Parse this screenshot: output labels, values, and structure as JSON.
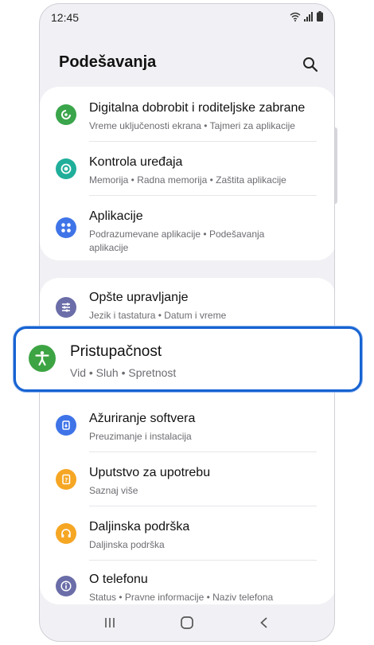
{
  "status": {
    "time": "12:45"
  },
  "header": {
    "title": "Podešavanja"
  },
  "groups": [
    {
      "items": [
        {
          "title": "Digitalna dobrobit i roditeljske zabrane",
          "subtitle": "Vreme uključenosti ekrana  •  Tajmeri za aplikacije",
          "icon": "digital-wellbeing-icon",
          "color": "#3aa54a"
        },
        {
          "title": "Kontrola uređaja",
          "subtitle": "Memorija  •  Radna memorija  •  Zaštita aplikacije",
          "icon": "device-care-icon",
          "color": "#1fae9a"
        },
        {
          "title": "Aplikacije",
          "subtitle": "Podrazumevane aplikacije  •  Podešavanja aplikacije",
          "icon": "apps-icon",
          "color": "#3f74e8"
        }
      ]
    },
    {
      "items": [
        {
          "title": "Opšte upravljanje",
          "subtitle": "Jezik i tastatura  •  Datum i vreme",
          "icon": "general-management-icon",
          "color": "#6a6da8"
        },
        {
          "title": "Ažuriranje softvera",
          "subtitle": "Preuzimanje i instalacija",
          "icon": "software-update-icon",
          "color": "#3f74e8"
        },
        {
          "title": "Uputstvo za upotrebu",
          "subtitle": "Saznaj više",
          "icon": "user-manual-icon",
          "color": "#f5a623"
        },
        {
          "title": "Daljinska podrška",
          "subtitle": "Daljinska podrška",
          "icon": "remote-support-icon",
          "color": "#f5a623"
        },
        {
          "title": "O telefonu",
          "subtitle": "Status  •  Pravne informacije  •  Naziv telefona",
          "icon": "about-phone-icon",
          "color": "#6a6da8"
        }
      ]
    }
  ],
  "highlighted": {
    "title": "Pristupačnost",
    "subtitle": "Vid  •  Sluh  •  Spretnost",
    "icon": "accessibility-icon",
    "color": "#3da443"
  },
  "nav": {
    "recents": "recents-icon",
    "home": "home-icon",
    "back": "back-icon"
  }
}
